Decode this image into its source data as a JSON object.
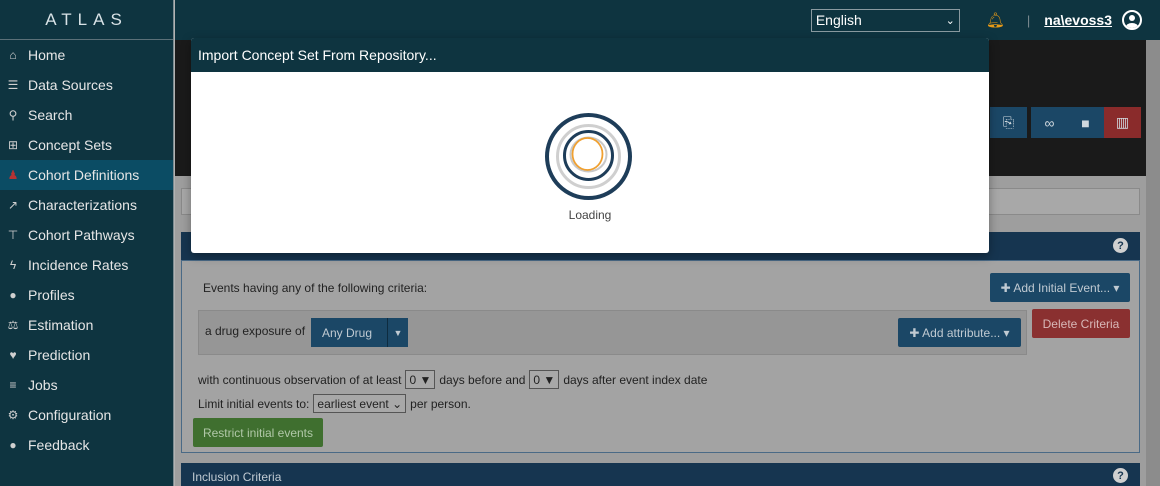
{
  "sidebar": {
    "brand": "ATLAS",
    "items": [
      {
        "label": "Home",
        "icon": "home-icon",
        "glyph": "⌂"
      },
      {
        "label": "Data Sources",
        "icon": "database-icon",
        "glyph": "☰"
      },
      {
        "label": "Search",
        "icon": "search-icon",
        "glyph": "⚲"
      },
      {
        "label": "Concept Sets",
        "icon": "cart-icon",
        "glyph": "⊞"
      },
      {
        "label": "Cohort Definitions",
        "icon": "users-icon",
        "glyph": "♟",
        "active": true
      },
      {
        "label": "Characterizations",
        "icon": "line-chart-icon",
        "glyph": "↗"
      },
      {
        "label": "Cohort Pathways",
        "icon": "sitemap-icon",
        "glyph": "⊤"
      },
      {
        "label": "Incidence Rates",
        "icon": "bolt-icon",
        "glyph": "ϟ"
      },
      {
        "label": "Profiles",
        "icon": "user-icon",
        "glyph": "●"
      },
      {
        "label": "Estimation",
        "icon": "balance-scale-icon",
        "glyph": "⚖"
      },
      {
        "label": "Prediction",
        "icon": "heartbeat-icon",
        "glyph": "♥"
      },
      {
        "label": "Jobs",
        "icon": "list-icon",
        "glyph": "≡"
      },
      {
        "label": "Configuration",
        "icon": "cogs-icon",
        "glyph": "⚙"
      },
      {
        "label": "Feedback",
        "icon": "comment-icon",
        "glyph": "●"
      }
    ]
  },
  "topbar": {
    "language": "English",
    "user": "na\\evoss3"
  },
  "page": {
    "events_label": "Events having any of the following criteria:",
    "add_initial_event": "✚ Add Initial Event... ▾",
    "drug_exposure_label": "a drug exposure of",
    "any_drug": "Any Drug",
    "add_attribute": "✚ Add attribute... ▾",
    "delete_criteria": "Delete Criteria",
    "obs_prefix": "with continuous observation of at least",
    "obs_before_value": "0 ▼",
    "obs_middle": "days before and",
    "obs_after_value": "0 ▼",
    "obs_suffix": "days after event index date",
    "limit_prefix": "Limit initial events to:",
    "limit_value": "earliest event ⌄",
    "limit_suffix": "per person.",
    "restrict_button": "Restrict initial events",
    "inclusion_criteria": "Inclusion Criteria"
  },
  "modal": {
    "title": "Import Concept Set From Repository...",
    "loading": "Loading"
  },
  "colors": {
    "navy": "#0e3440",
    "active_nav": "#0b4c64",
    "spinner_outer": "#1e3d59",
    "spinner_inner": "#f0a030"
  }
}
